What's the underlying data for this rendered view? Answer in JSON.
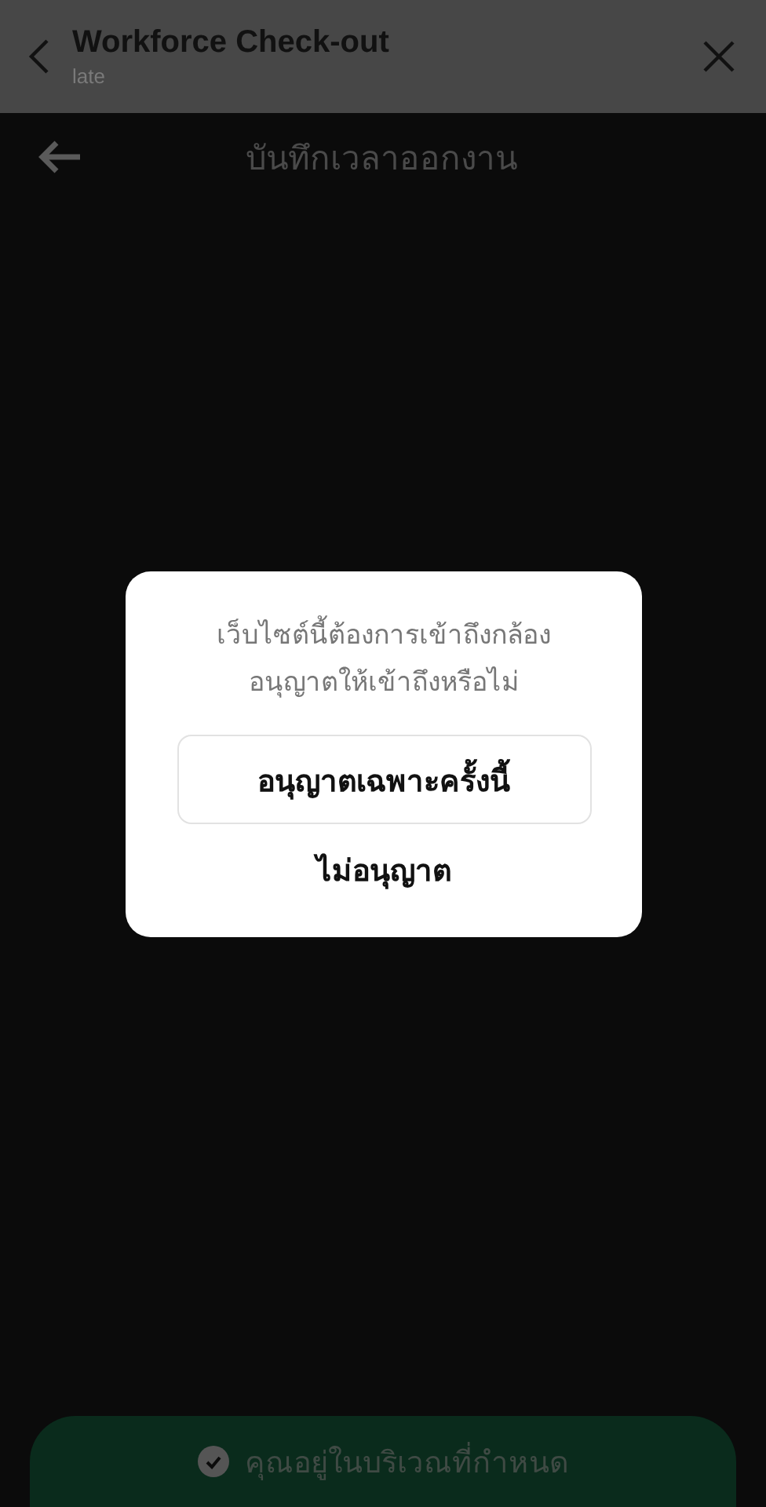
{
  "app_bar": {
    "title": "Workforce Check-out",
    "subtitle": "late"
  },
  "page": {
    "title": "บันทึกเวลาออกงาน"
  },
  "location_status": {
    "text": "คุณอยู่ในบริเวณที่กำหนด"
  },
  "dialog": {
    "message": [
      "เว็บไซต์นี้ต้องการเข้าถึงกล้อง",
      "อนุญาตให้เข้าถึงหรือไม่"
    ],
    "buttons": [
      {
        "label": "อนุญาตเฉพาะครั้งนี้",
        "kind": "outlined"
      },
      {
        "label": "ไม่อนุญาต",
        "kind": "text"
      }
    ]
  }
}
